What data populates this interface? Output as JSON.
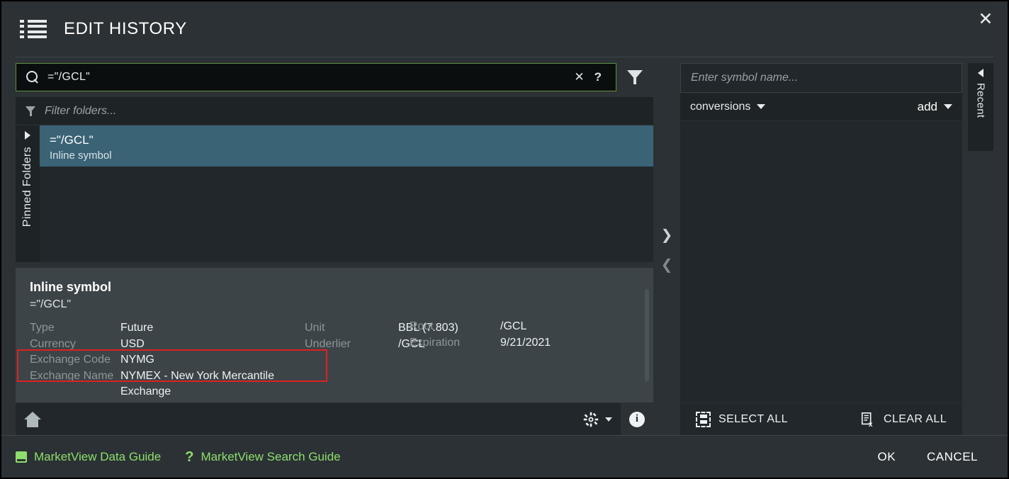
{
  "window": {
    "title": "EDIT HISTORY",
    "menu_icon": "list-icon",
    "close_icon": "close-icon"
  },
  "search": {
    "icon": "search-icon",
    "value": "=\"/GCL\"",
    "clear_icon": "close-icon",
    "help_icon": "question-mark-icon",
    "filter_icon": "funnel-icon"
  },
  "folder_filter": {
    "icon": "funnel-icon",
    "placeholder": "Filter folders..."
  },
  "pinned_folders": {
    "label": "Pinned Folders",
    "expand_icon": "chevron-right-icon"
  },
  "results": [
    {
      "title": "=\"/GCL\"",
      "subtitle": "Inline symbol",
      "selected": true
    }
  ],
  "details": {
    "heading": "Inline symbol",
    "subheading": "=\"/GCL\"",
    "fields": [
      {
        "key": "Type",
        "value": "Future",
        "key2": "Unit",
        "value2": "BBL (7.803)",
        "key3": "Root",
        "value3": "/GCL"
      },
      {
        "key": "Currency",
        "value": "USD",
        "key2": "Underlier",
        "value2": "/GCL",
        "key3": "Expiration",
        "value3": "9/21/2021"
      },
      {
        "key": "Exchange Code",
        "value": "NYMG",
        "key2": "",
        "value2": "",
        "key3": "",
        "value3": ""
      },
      {
        "key": "Exchange Name",
        "value": "NYMEX - New York Mercantile Exchange",
        "key2": "",
        "value2": "",
        "key3": "",
        "value3": ""
      }
    ],
    "highlight_color": "#e02020"
  },
  "left_toolbar": {
    "home_icon": "home-icon",
    "settings_icon": "gear-icon",
    "settings_caret_icon": "chevron-down-icon",
    "info_icon": "info-icon"
  },
  "splitter": {
    "forward_icon": "chevron-right-icon",
    "back_icon": "chevron-left-icon"
  },
  "right_panel": {
    "symbol_input_placeholder": "Enter symbol name...",
    "symbol_input_value": "",
    "list_selector_label": "conversions",
    "list_selector_caret": "chevron-down-icon",
    "add_label": "add",
    "add_caret": "chevron-down-icon",
    "select_all_label": "SELECT ALL",
    "select_all_icon": "select-all-icon",
    "clear_all_label": "CLEAR ALL",
    "clear_all_icon": "clear-all-icon",
    "items": []
  },
  "recent_tab": {
    "label": "Recent",
    "collapse_icon": "chevron-left-icon"
  },
  "footer": {
    "data_guide_label": "MarketView Data Guide",
    "data_guide_icon": "book-icon",
    "search_guide_label": "MarketView Search Guide",
    "search_guide_icon": "question-mark-icon",
    "ok_label": "OK",
    "cancel_label": "CANCEL",
    "link_color": "#8ede6d"
  }
}
